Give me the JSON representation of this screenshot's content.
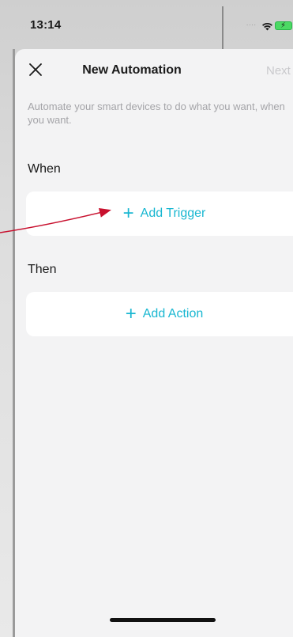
{
  "status_bar": {
    "time": "13:14",
    "signal_dots": "....",
    "wifi_icon": "wifi-icon",
    "battery_icon": "battery-charging-icon"
  },
  "nav": {
    "close_icon": "close-icon",
    "title": "New Automation",
    "next_label": "Next"
  },
  "subtitle": "Automate your smart devices to do what you want, when you want.",
  "when": {
    "label": "When",
    "add_trigger": {
      "icon": "plus-icon",
      "plus": "+",
      "label": "Add Trigger"
    }
  },
  "then": {
    "label": "Then",
    "add_action": {
      "icon": "plus-icon",
      "plus": "+",
      "label": "Add Action"
    }
  },
  "colors": {
    "accent": "#19b7d1",
    "annotation_arrow": "#c8102e",
    "sheet_background": "#f3f3f4",
    "next_disabled": "#c9c9cc"
  }
}
